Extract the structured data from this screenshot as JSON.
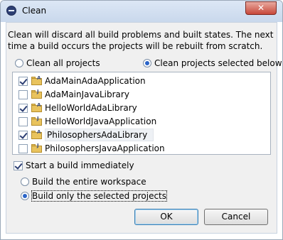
{
  "window": {
    "title": "Clean",
    "close_glyph": "✕",
    "title_icon": "eclipse-icon"
  },
  "description": "Clean will discard all build problems and built states.  The next time a build occurs the projects will be rebuilt from scratch.",
  "scope": {
    "all_label": "Clean all projects",
    "selected_label": "Clean projects selected below",
    "selected": "selected"
  },
  "projects": [
    {
      "name": "AdaMainAdaApplication",
      "checked": true
    },
    {
      "name": "AdaMainJavaLibrary",
      "checked": false
    },
    {
      "name": "HelloWorldAdaLibrary",
      "checked": true
    },
    {
      "name": "HelloWorldJavaApplication",
      "checked": false
    },
    {
      "name": "PhilosophersAdaLibrary",
      "checked": true
    },
    {
      "name": "PhilosophersJavaApplication",
      "checked": false
    }
  ],
  "build": {
    "start_label": "Start a build immediately",
    "start_checked": true,
    "entire_label": "Build the entire workspace",
    "selected_label": "Build only the selected projects",
    "mode": "selected"
  },
  "buttons": {
    "ok": "OK",
    "cancel": "Cancel"
  },
  "colors": {
    "accent": "#2a64c8",
    "title_bar": "#c9d8ec",
    "close": "#c7483a"
  }
}
